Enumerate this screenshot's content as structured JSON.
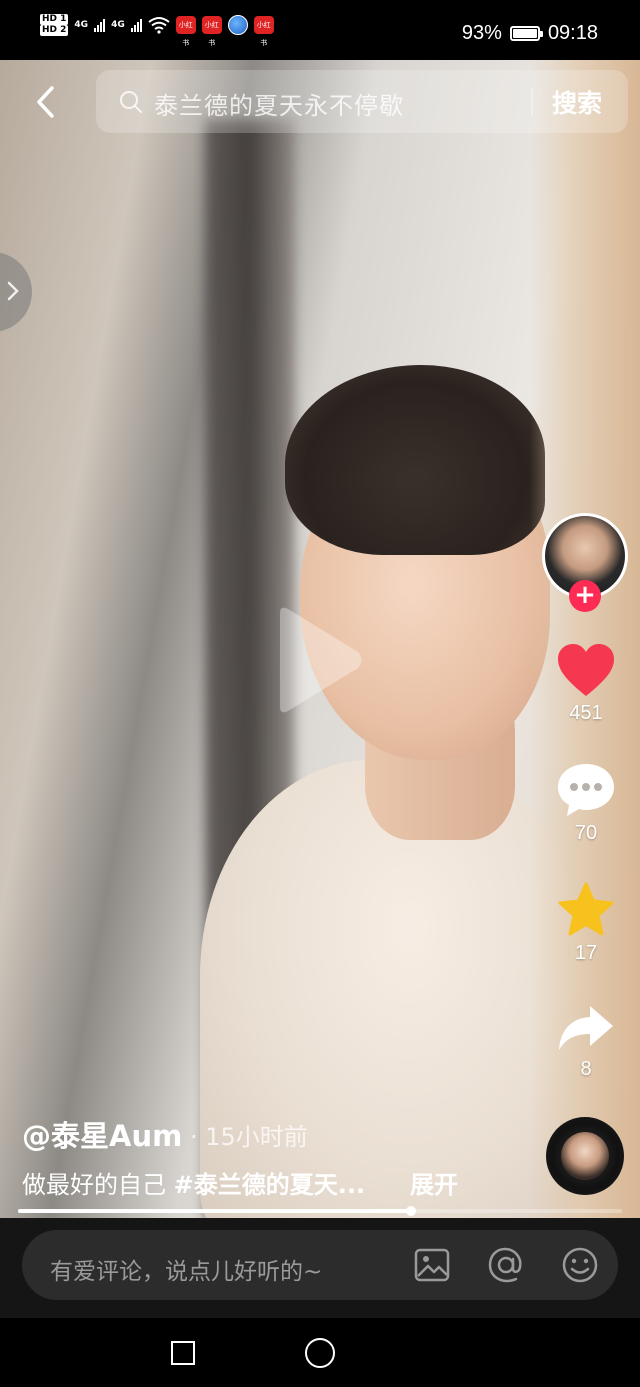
{
  "status_bar": {
    "sim1": "HD 1",
    "sim2": "HD 2",
    "net1": "4G",
    "net2": "4G",
    "app_badge": "小红书",
    "battery_text": "93%",
    "battery_level": 0.93,
    "time": "09:18"
  },
  "search": {
    "query": "泰兰德的夏天永不停歇",
    "button_label": "搜索"
  },
  "video": {
    "author": "@泰星Aum",
    "posted": "· 15小时前",
    "caption_text": "做最好的自己 ",
    "caption_tag": "#泰兰德的夏天...",
    "expand_label": "展开",
    "progress": 0.65
  },
  "actions": {
    "follow_symbol": "+",
    "likes": "451",
    "comments": "70",
    "favorites": "17",
    "shares": "8"
  },
  "comment_bar": {
    "placeholder": "有爱评论，说点儿好听的~"
  },
  "colors": {
    "accent_red": "#fe2c55",
    "star_yellow": "#f7c21d",
    "heart_red": "#f5384f"
  }
}
